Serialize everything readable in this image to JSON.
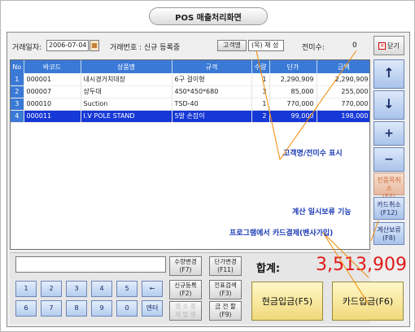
{
  "page_title": "POS 매출처리화면",
  "header": {
    "date_label": "거래일자:",
    "date_value": "2006-07-04",
    "trans_label": "거래번호 : 신규 등록중",
    "customer_button": "고객명",
    "customer_value": "(목) 재 성",
    "unpaid_label": "전미수:",
    "unpaid_value": "0",
    "close_button": "닫기"
  },
  "table": {
    "columns": [
      "No",
      "바코드",
      "상품명",
      "규격",
      "수량",
      "단가",
      "금액"
    ],
    "rows": [
      [
        "1",
        "000001",
        "내시경거치대장",
        "6구 걸이형",
        "1",
        "2,290,909",
        "2,290,909"
      ],
      [
        "2",
        "000007",
        "상두대",
        "450*450*680",
        "3",
        "85,000",
        "255,000"
      ],
      [
        "3",
        "000010",
        "Suction",
        "TSD-40",
        "1",
        "770,000",
        "770,000"
      ],
      [
        "4",
        "000011",
        "I.V POLE STAND",
        "5발 손잡이",
        "2",
        "99,000",
        "198,000"
      ]
    ],
    "selected_row": 3
  },
  "right_column": {
    "up": "↑",
    "down": "↓",
    "plus": "+",
    "minus": "−",
    "btn1": "전품목취소\n(F4)",
    "btn2": "카드취소\n(F12)",
    "btn3": "계산보류\n(F8)"
  },
  "function_buttons": {
    "qty_change": "수량변경\n(F7)",
    "price_change": "단가변경\n(F11)",
    "new_register": "신규등록\n(F2)",
    "slip_search": "전표검색\n(F3)",
    "receipt_print": "영 수 증\n재 발 행",
    "discount": "금 전 할\n(F9)"
  },
  "keypad": {
    "row1": [
      "1",
      "2",
      "3",
      "4",
      "5",
      "←"
    ],
    "row2": [
      "6",
      "7",
      "8",
      "9",
      "0",
      "엔터"
    ]
  },
  "total": {
    "label": "합계:",
    "value": "3,513,909"
  },
  "pay_buttons": {
    "cash": "현금입금(F5)",
    "card": "카드입금(F6)"
  },
  "annotations": {
    "a1": "고객명/전미수 표시",
    "a2": "계산 일시보류 기능",
    "a3": "프로그램에서 카드결제(밴사가입)"
  },
  "colors": {
    "header_blue": "#3a7ad6",
    "selected_row": "#1638d6",
    "total_red": "#e01b1b",
    "annotation_blue": "#1a3ab5",
    "callout_orange": "#f08a00"
  }
}
